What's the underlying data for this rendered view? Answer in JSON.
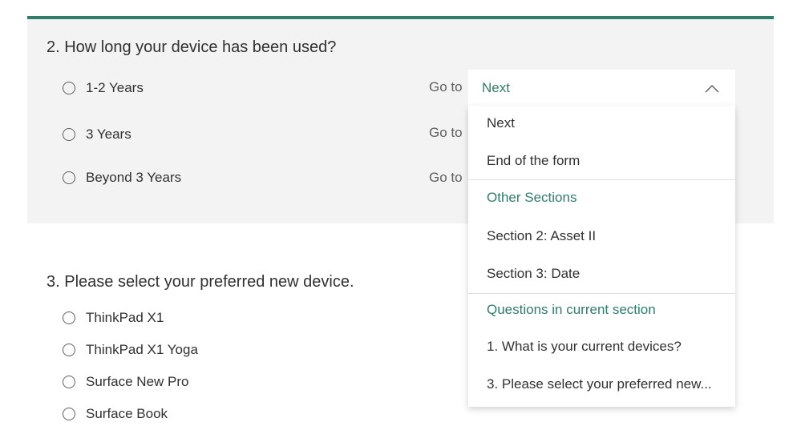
{
  "question2": {
    "title": "2. How long your device has been used?",
    "options": [
      {
        "label": "1-2 Years",
        "goto_label": "Go to"
      },
      {
        "label": "3 Years",
        "goto_label": "Go to"
      },
      {
        "label": "Beyond 3 Years",
        "goto_label": "Go to"
      }
    ],
    "select": {
      "value": "Next"
    }
  },
  "dropdown": {
    "items": [
      {
        "label": "Next"
      },
      {
        "label": "End of the form"
      }
    ],
    "other_sections_header": "Other Sections",
    "sections": [
      {
        "label": "Section 2: Asset II"
      },
      {
        "label": "Section 3: Date"
      }
    ],
    "questions_header": "Questions in current section",
    "questions": [
      {
        "label": "1. What is your current devices?"
      },
      {
        "label": "3. Please select your preferred new..."
      }
    ]
  },
  "question3": {
    "title": "3. Please select your preferred new device.",
    "options": [
      {
        "label": "ThinkPad X1"
      },
      {
        "label": "ThinkPad X1 Yoga"
      },
      {
        "label": "Surface New Pro"
      },
      {
        "label": "Surface Book"
      }
    ]
  },
  "colors": {
    "accent": "#2f7d6a",
    "card_background": "#f3f3f3"
  },
  "icons": {
    "radio": "radio-circle",
    "select_chevron": "chevron-up-icon"
  }
}
